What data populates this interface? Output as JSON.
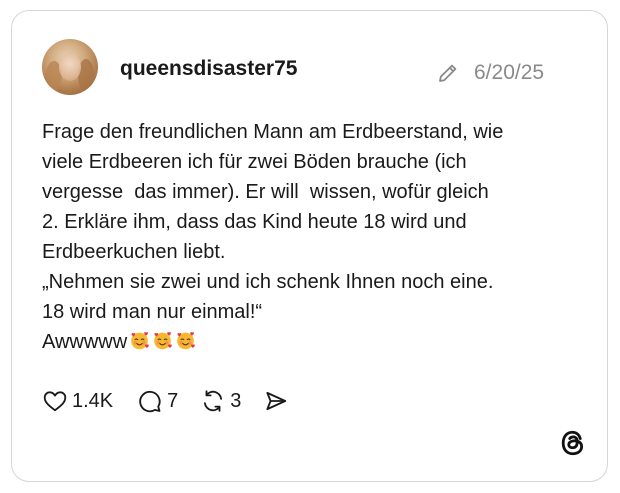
{
  "post": {
    "username": "queensdisaster75",
    "date": "6/20/25",
    "lines": [
      "Frage den freundlichen Mann am Erdbeerstand, wie",
      "viele Erdbeeren ich für zwei Böden brauche (ich",
      "vergesse  das immer). Er will  wissen, wofür gleich",
      "2. Erkläre ihm, dass das Kind heute 18 wird und",
      "Erdbeerkuchen liebt.",
      "„Nehmen sie zwei und ich schenk Ihnen noch eine.",
      "18 wird man nur einmal!“",
      "Awwwww"
    ],
    "emoji_name": "smiling-face-with-hearts-icon",
    "emoji_count": 3
  },
  "actions": {
    "likes": "1.4K",
    "comments": "7",
    "reposts": "3"
  },
  "icons": {
    "edit": "pencil-icon",
    "like": "heart-icon",
    "comment": "speech-bubble-icon",
    "repost": "repost-arrows-icon",
    "share": "send-icon",
    "brand": "threads-logo-icon"
  },
  "colors": {
    "text": "#1a1a1a",
    "muted": "#8a8a8a",
    "border": "#d6d6d6",
    "background": "#ffffff"
  }
}
